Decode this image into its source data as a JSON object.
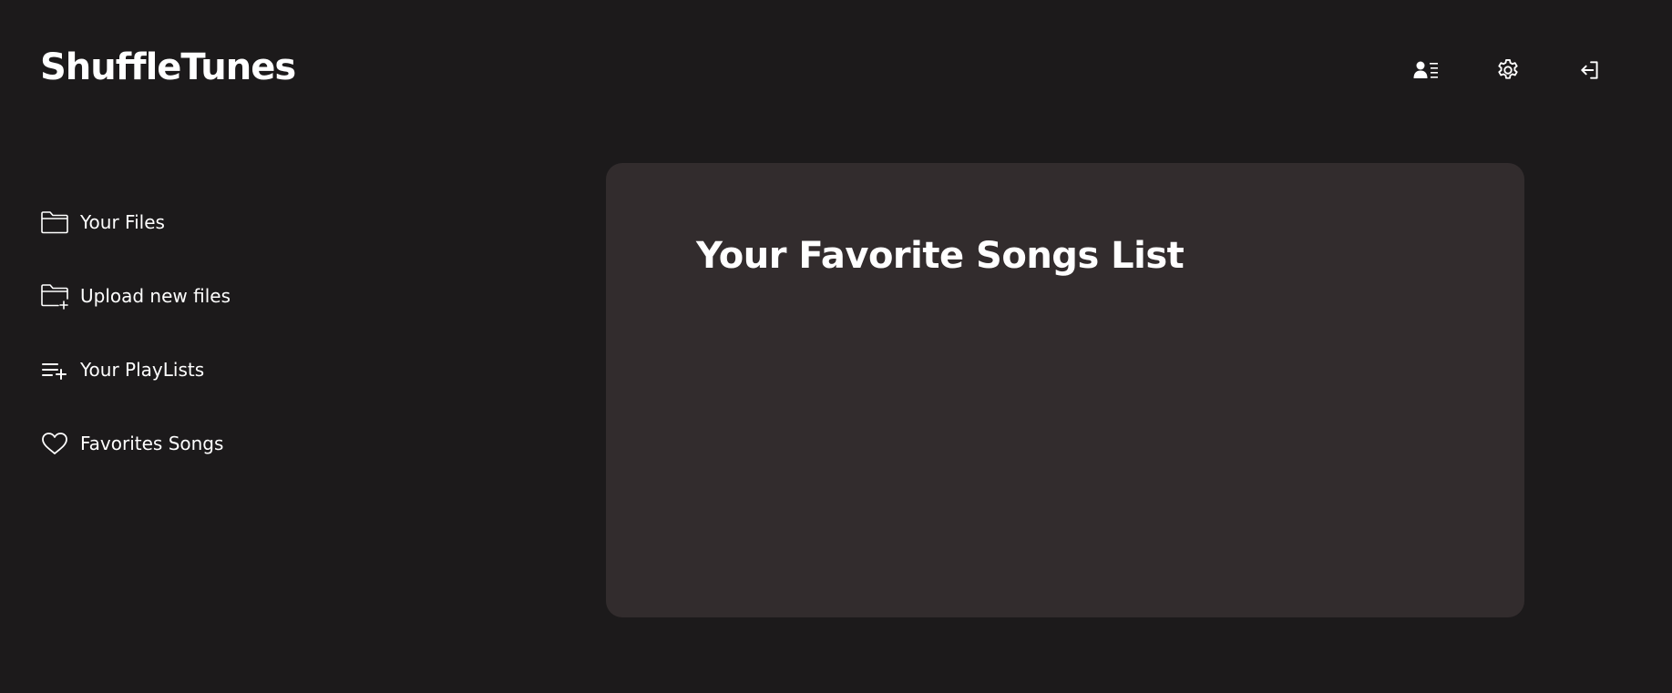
{
  "app": {
    "brand": "ShuffleTunes"
  },
  "header": {
    "actions": [
      {
        "name": "profile",
        "icon": "user-list-icon"
      },
      {
        "name": "settings",
        "icon": "gear-icon"
      },
      {
        "name": "logout",
        "icon": "sign-in-arrow-icon"
      }
    ]
  },
  "sidebar": {
    "items": [
      {
        "label": "Your Files",
        "icon": "folder-icon"
      },
      {
        "label": "Upload new files",
        "icon": "folder-plus-icon"
      },
      {
        "label": "Your PlayLists",
        "icon": "playlist-add-icon"
      },
      {
        "label": "Favorites Songs",
        "icon": "heart-icon"
      }
    ]
  },
  "main": {
    "title": "Your Favorite Songs List"
  },
  "colors": {
    "background": "#1c1a1b",
    "panel": "#322c2d",
    "text": "#ffffff"
  }
}
